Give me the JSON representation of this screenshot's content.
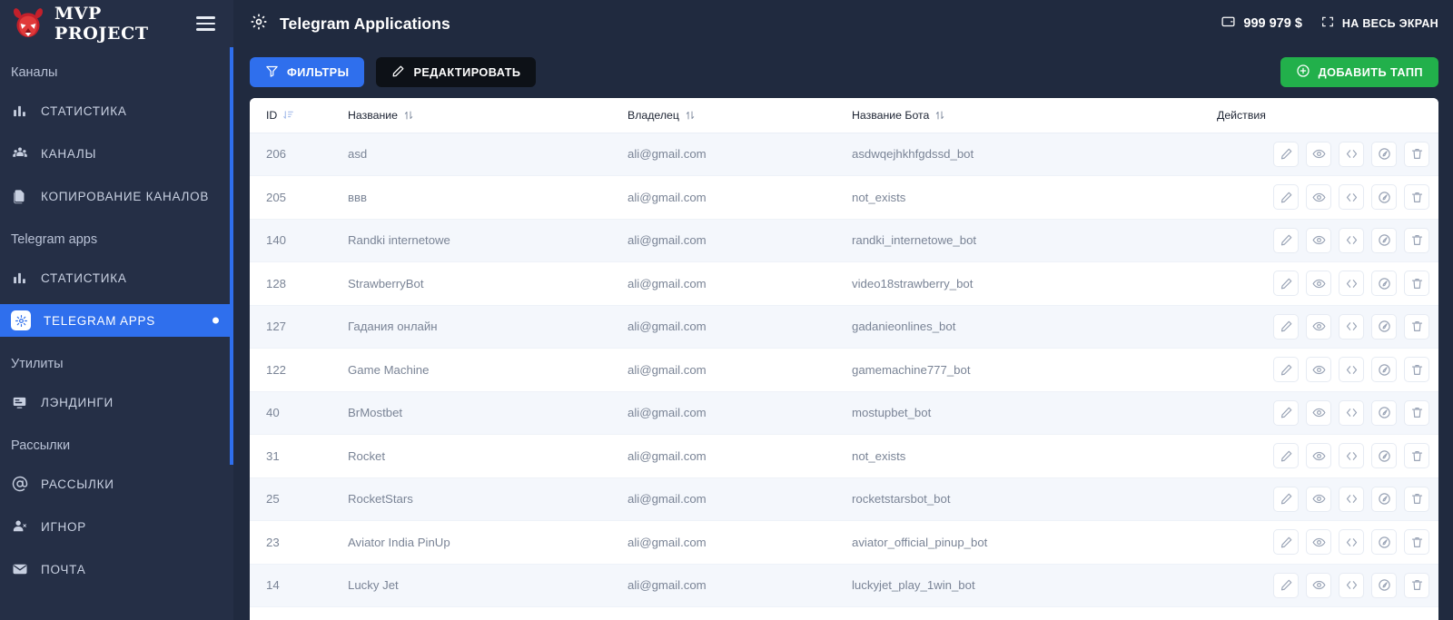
{
  "brand": {
    "name": "MVP PROJECT",
    "logo_icon": "devil-head-logo",
    "menu_icon": "hamburger-menu-icon"
  },
  "sidebar": {
    "groups": [
      {
        "title": "Каналы",
        "items": [
          {
            "label": "СТАТИСТИКА",
            "icon": "bar-chart-icon",
            "active": false
          },
          {
            "label": "КАНАЛЫ",
            "icon": "users-group-icon",
            "active": false
          },
          {
            "label": "КОПИРОВАНИЕ КАНАЛОВ",
            "icon": "copy-document-icon",
            "active": false
          }
        ]
      },
      {
        "title": "Telegram apps",
        "items": [
          {
            "label": "СТАТИСТИКА",
            "icon": "bar-chart-icon",
            "active": false
          },
          {
            "label": "TELEGRAM APPS",
            "icon": "gear-icon",
            "active": true
          }
        ]
      },
      {
        "title": "Утилиты",
        "items": [
          {
            "label": "ЛЭНДИНГИ",
            "icon": "landing-page-icon",
            "active": false
          }
        ]
      },
      {
        "title": "Рассылки",
        "items": [
          {
            "label": "РАССЫЛКИ",
            "icon": "at-sign-icon",
            "active": false
          },
          {
            "label": "ИГНОР",
            "icon": "user-remove-icon",
            "active": false
          },
          {
            "label": "ПОЧТА",
            "icon": "envelope-icon",
            "active": false
          }
        ]
      }
    ]
  },
  "topbar": {
    "title": "Telegram Applications",
    "title_icon": "gear-icon",
    "balance": "999 979 $",
    "balance_icon": "wallet-icon",
    "fullscreen_label": "НА ВЕСЬ ЭКРАН",
    "fullscreen_icon": "fullscreen-icon"
  },
  "toolbar": {
    "filters_label": "ФИЛЬТРЫ",
    "filters_icon": "funnel-icon",
    "edit_label": "РЕДАКТИРОВАТЬ",
    "edit_icon": "pencil-icon",
    "add_label": "ДОБАВИТЬ ТАПП",
    "add_icon": "plus-circle-icon"
  },
  "table": {
    "columns": [
      {
        "label": "ID",
        "sort": "desc",
        "sort_icon": "sort-descending-icon"
      },
      {
        "label": "Название",
        "sort": "none",
        "sort_icon": "sort-updown-icon"
      },
      {
        "label": "Владелец",
        "sort": "none",
        "sort_icon": "sort-updown-icon"
      },
      {
        "label": "Название Бота",
        "sort": "none",
        "sort_icon": "sort-updown-icon"
      },
      {
        "label": "Действия",
        "sort": null,
        "sort_icon": null
      }
    ],
    "row_actions": [
      "pencil-icon",
      "eye-icon",
      "code-brackets-icon",
      "speedometer-icon",
      "trash-icon"
    ],
    "rows": [
      {
        "id": "206",
        "name": "asd",
        "owner": "ali@gmail.com",
        "bot": "asdwqejhkhfgdssd_bot"
      },
      {
        "id": "205",
        "name": "ввв",
        "owner": "ali@gmail.com",
        "bot": "not_exists"
      },
      {
        "id": "140",
        "name": "Randki internetowe",
        "owner": "ali@gmail.com",
        "bot": "randki_internetowe_bot"
      },
      {
        "id": "128",
        "name": "StrawberryBot",
        "owner": "ali@gmail.com",
        "bot": "video18strawberry_bot"
      },
      {
        "id": "127",
        "name": "Гадания онлайн",
        "owner": "ali@gmail.com",
        "bot": "gadanieonlines_bot"
      },
      {
        "id": "122",
        "name": "Game Machine",
        "owner": "ali@gmail.com",
        "bot": "gamemachine777_bot"
      },
      {
        "id": "40",
        "name": "BrMostbet",
        "owner": "ali@gmail.com",
        "bot": "mostupbet_bot"
      },
      {
        "id": "31",
        "name": "Rocket",
        "owner": "ali@gmail.com",
        "bot": "not_exists"
      },
      {
        "id": "25",
        "name": "RocketStars",
        "owner": "ali@gmail.com",
        "bot": "rocketstarsbot_bot"
      },
      {
        "id": "23",
        "name": "Aviator India PinUp",
        "owner": "ali@gmail.com",
        "bot": "aviator_official_pinup_bot"
      },
      {
        "id": "14",
        "name": "Lucky Jet",
        "owner": "ali@gmail.com",
        "bot": "luckyjet_play_1win_bot"
      }
    ]
  },
  "colors": {
    "sidebar_bg": "#252f46",
    "topbar_bg": "#202a3f",
    "accent_blue": "#2f6fed",
    "green": "#22b04b",
    "black_btn": "#0d1117",
    "row_alt": "#f4f7fc"
  }
}
